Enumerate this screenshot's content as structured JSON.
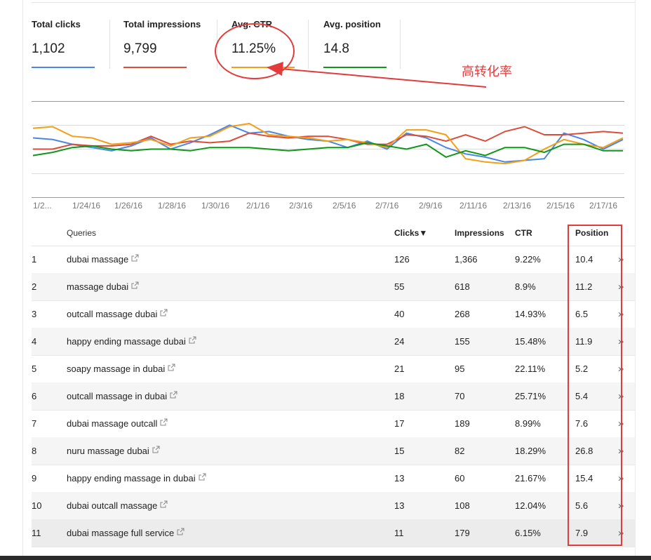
{
  "metrics": [
    {
      "label": "Total clicks",
      "value": "1,102",
      "color": "#4a86e8"
    },
    {
      "label": "Total impressions",
      "value": "9,799",
      "color": "#dd4b39"
    },
    {
      "label": "Avg. CTR",
      "value": "11.25%",
      "color": "#f29e16"
    },
    {
      "label": "Avg. position",
      "value": "14.8",
      "color": "#109618"
    }
  ],
  "annotation": {
    "text": "高转化率"
  },
  "chart_data": {
    "type": "line",
    "x_tick_labels": [
      "1/2...",
      "1/24/16",
      "1/26/16",
      "1/28/16",
      "1/30/16",
      "2/1/16",
      "2/3/16",
      "2/5/16",
      "2/7/16",
      "2/9/16",
      "2/11/16",
      "2/13/16",
      "2/15/16",
      "2/17/16"
    ],
    "grid": true,
    "series": [
      {
        "metric": "Total clicks",
        "color": "#4a86e8",
        "values": [
          37,
          36,
          33,
          31,
          29,
          32,
          37,
          30,
          34,
          39,
          45,
          40,
          41,
          38,
          36,
          35,
          31,
          35,
          30,
          40,
          37,
          31,
          27,
          25,
          22,
          23,
          24,
          40,
          36,
          30,
          36
        ]
      },
      {
        "metric": "Total impressions",
        "color": "#dd4b39",
        "values": [
          30,
          30,
          33,
          32,
          32,
          33,
          38,
          33,
          35,
          34,
          35,
          40,
          38,
          37,
          38,
          38,
          36,
          33,
          33,
          39,
          38,
          35,
          39,
          35,
          41,
          44,
          39,
          39,
          40,
          41,
          40
        ]
      },
      {
        "metric": "Avg. CTR",
        "color": "#f29e16",
        "values": [
          43,
          44,
          38,
          37,
          33,
          34,
          36,
          32,
          37,
          38,
          44,
          46,
          39,
          38,
          37,
          35,
          36,
          34,
          31,
          42,
          42,
          39,
          24,
          22,
          21,
          23,
          30,
          36,
          33,
          31,
          37
        ]
      },
      {
        "metric": "Avg. position",
        "color": "#109618",
        "values": [
          26,
          28,
          31,
          32,
          30,
          29,
          30,
          30,
          29,
          31,
          31,
          31,
          30,
          29,
          30,
          31,
          31,
          34,
          32,
          30,
          33,
          25,
          29,
          26,
          31,
          31,
          28,
          33,
          33,
          29,
          29
        ]
      }
    ]
  },
  "table": {
    "headers": {
      "queries": "Queries",
      "clicks": "Clicks▼",
      "impressions": "Impressions",
      "ctr": "CTR",
      "position": "Position"
    },
    "rows": [
      {
        "n": "1",
        "query": "dubai massage",
        "clicks": "126",
        "impressions": "1,366",
        "ctr": "9.22%",
        "position": "10.4"
      },
      {
        "n": "2",
        "query": "massage dubai",
        "clicks": "55",
        "impressions": "618",
        "ctr": "8.9%",
        "position": "11.2"
      },
      {
        "n": "3",
        "query": "outcall massage dubai",
        "clicks": "40",
        "impressions": "268",
        "ctr": "14.93%",
        "position": "6.5"
      },
      {
        "n": "4",
        "query": "happy ending massage dubai",
        "clicks": "24",
        "impressions": "155",
        "ctr": "15.48%",
        "position": "11.9"
      },
      {
        "n": "5",
        "query": "soapy massage in dubai",
        "clicks": "21",
        "impressions": "95",
        "ctr": "22.11%",
        "position": "5.2"
      },
      {
        "n": "6",
        "query": "outcall massage in dubai",
        "clicks": "18",
        "impressions": "70",
        "ctr": "25.71%",
        "position": "5.4"
      },
      {
        "n": "7",
        "query": "dubai massage outcall",
        "clicks": "17",
        "impressions": "189",
        "ctr": "8.99%",
        "position": "7.6"
      },
      {
        "n": "8",
        "query": "nuru massage dubai",
        "clicks": "15",
        "impressions": "82",
        "ctr": "18.29%",
        "position": "26.8"
      },
      {
        "n": "9",
        "query": "happy ending massage in dubai",
        "clicks": "13",
        "impressions": "60",
        "ctr": "21.67%",
        "position": "15.4"
      },
      {
        "n": "10",
        "query": "dubai outcall massage",
        "clicks": "13",
        "impressions": "108",
        "ctr": "12.04%",
        "position": "5.6"
      },
      {
        "n": "11",
        "query": "dubai massage full service",
        "clicks": "11",
        "impressions": "179",
        "ctr": "6.15%",
        "position": "7.9"
      }
    ]
  },
  "icons": {
    "external": "external-link-icon",
    "expand": "double-chevron-right-icon"
  }
}
